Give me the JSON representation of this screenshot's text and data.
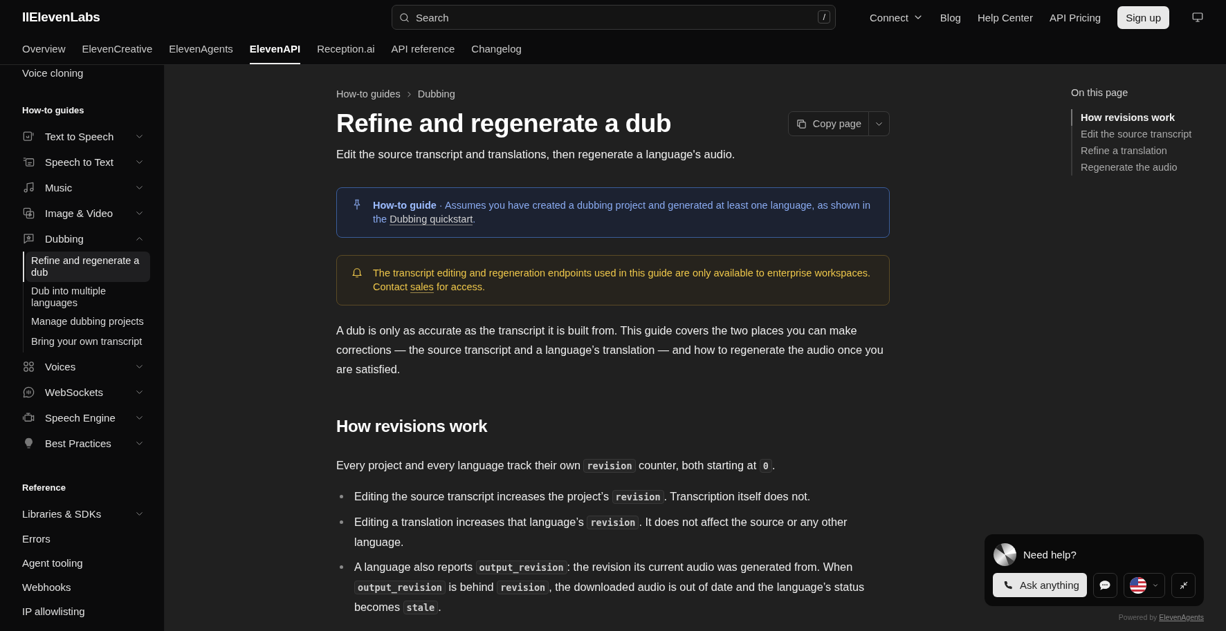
{
  "header": {
    "logo": "IIElevenLabs",
    "search": {
      "placeholder": "Search",
      "shortcut": "/"
    },
    "nav": [
      {
        "label": "Connect",
        "kind": "menu"
      },
      {
        "label": "Blog",
        "kind": "link"
      },
      {
        "label": "Help Center",
        "kind": "link"
      },
      {
        "label": "API Pricing",
        "kind": "link"
      },
      {
        "label": "Sign up",
        "kind": "button"
      }
    ],
    "tabs": [
      {
        "label": "Overview",
        "selected": false
      },
      {
        "label": "ElevenCreative",
        "selected": false
      },
      {
        "label": "ElevenAgents",
        "selected": false
      },
      {
        "label": "ElevenAPI",
        "selected": true
      },
      {
        "label": "Reception.ai",
        "selected": false
      },
      {
        "label": "API reference",
        "selected": false
      },
      {
        "label": "Changelog",
        "selected": false
      }
    ]
  },
  "sidebar": {
    "lead_items": [
      {
        "label": "Voice cloning"
      }
    ],
    "sections": [
      {
        "title": "How-to guides",
        "items": [
          {
            "label": "Text to Speech",
            "kind": "icon_group",
            "expanded": false
          },
          {
            "label": "Speech to Text",
            "kind": "icon_group",
            "expanded": false
          },
          {
            "label": "Music",
            "kind": "icon_group",
            "expanded": false
          },
          {
            "label": "Image & Video",
            "kind": "icon_group",
            "expanded": false
          },
          {
            "label": "Dubbing",
            "kind": "icon_group",
            "expanded": true,
            "children": [
              {
                "label": "Refine and regenerate a dub",
                "selected": true
              },
              {
                "label": "Dub into multiple languages",
                "selected": false
              },
              {
                "label": "Manage dubbing projects",
                "selected": false
              },
              {
                "label": "Bring your own transcript",
                "selected": false
              }
            ]
          },
          {
            "label": "Voices",
            "kind": "icon_group",
            "expanded": false
          },
          {
            "label": "WebSockets",
            "kind": "icon_group",
            "expanded": false
          },
          {
            "label": "Speech Engine",
            "kind": "icon_group",
            "expanded": false
          },
          {
            "label": "Best Practices",
            "kind": "icon_group",
            "expanded": false
          }
        ]
      },
      {
        "title": "Reference",
        "items": [
          {
            "label": "Libraries & SDKs",
            "kind": "group",
            "expanded": false
          },
          {
            "label": "Errors",
            "kind": "link"
          },
          {
            "label": "Agent tooling",
            "kind": "link"
          },
          {
            "label": "Webhooks",
            "kind": "link"
          },
          {
            "label": "IP allowlisting",
            "kind": "link"
          }
        ]
      }
    ]
  },
  "article": {
    "breadcrumb": [
      "How-to guides",
      "Dubbing"
    ],
    "title": "Refine and regenerate a dub",
    "subtitle": "Edit the source transcript and translations, then regenerate a language's audio.",
    "copy_button": "Copy page",
    "callouts": [
      {
        "kind": "info",
        "parts": [
          {
            "kind": "bold",
            "text": "How-to guide"
          },
          {
            "kind": "text",
            "text": " · Assumes you have created a dubbing project and generated at least one language, as shown in the "
          },
          {
            "kind": "link",
            "text": "Dubbing quickstart"
          },
          {
            "kind": "text",
            "text": "."
          }
        ]
      },
      {
        "kind": "warning",
        "parts": [
          {
            "kind": "text",
            "text": "The transcript editing and regeneration endpoints used in this guide are only available to enterprise workspaces. Contact "
          },
          {
            "kind": "link",
            "text": "sales"
          },
          {
            "kind": "text",
            "text": " for access."
          }
        ]
      }
    ],
    "blocks": [
      {
        "kind": "paragraph",
        "parts": [
          {
            "kind": "text",
            "text": "A dub is only as accurate as the transcript it is built from. This guide covers the two places you can make corrections — the source transcript and a language’s translation — and how to regenerate the audio once you are satisfied."
          }
        ]
      },
      {
        "kind": "heading",
        "text": "How revisions work"
      },
      {
        "kind": "paragraph",
        "parts": [
          {
            "kind": "text",
            "text": "Every project and every language track their own "
          },
          {
            "kind": "code",
            "text": "revision"
          },
          {
            "kind": "text",
            "text": " counter, both starting at "
          },
          {
            "kind": "code",
            "text": "0"
          },
          {
            "kind": "text",
            "text": "."
          }
        ]
      },
      {
        "kind": "list",
        "items": [
          {
            "parts": [
              {
                "kind": "text",
                "text": "Editing the source transcript increases the project’s "
              },
              {
                "kind": "code",
                "text": "revision"
              },
              {
                "kind": "text",
                "text": ". Transcription itself does not."
              }
            ]
          },
          {
            "parts": [
              {
                "kind": "text",
                "text": "Editing a translation increases that language’s "
              },
              {
                "kind": "code",
                "text": "revision"
              },
              {
                "kind": "text",
                "text": ". It does not affect the source or any other language."
              }
            ]
          },
          {
            "parts": [
              {
                "kind": "text",
                "text": "A language also reports "
              },
              {
                "kind": "code",
                "text": "output_revision"
              },
              {
                "kind": "text",
                "text": ": the revision its current audio was generated from. When "
              },
              {
                "kind": "code",
                "text": "output_revision"
              },
              {
                "kind": "text",
                "text": " is behind "
              },
              {
                "kind": "code",
                "text": "revision"
              },
              {
                "kind": "text",
                "text": ", the downloaded audio is out of date and the language’s status becomes "
              },
              {
                "kind": "code",
                "text": "stale"
              },
              {
                "kind": "text",
                "text": "."
              }
            ]
          }
        ]
      }
    ]
  },
  "toc": {
    "title": "On this page",
    "items": [
      {
        "label": "How revisions work",
        "selected": true
      },
      {
        "label": "Edit the source transcript",
        "selected": false
      },
      {
        "label": "Refine a translation",
        "selected": false
      },
      {
        "label": "Regenerate the audio",
        "selected": false
      }
    ]
  },
  "help_widget": {
    "title": "Need help?",
    "ask_button": "Ask anything",
    "footer": [
      {
        "kind": "text",
        "text": "Powered by "
      },
      {
        "kind": "link",
        "text": "ElevenAgents"
      }
    ]
  }
}
